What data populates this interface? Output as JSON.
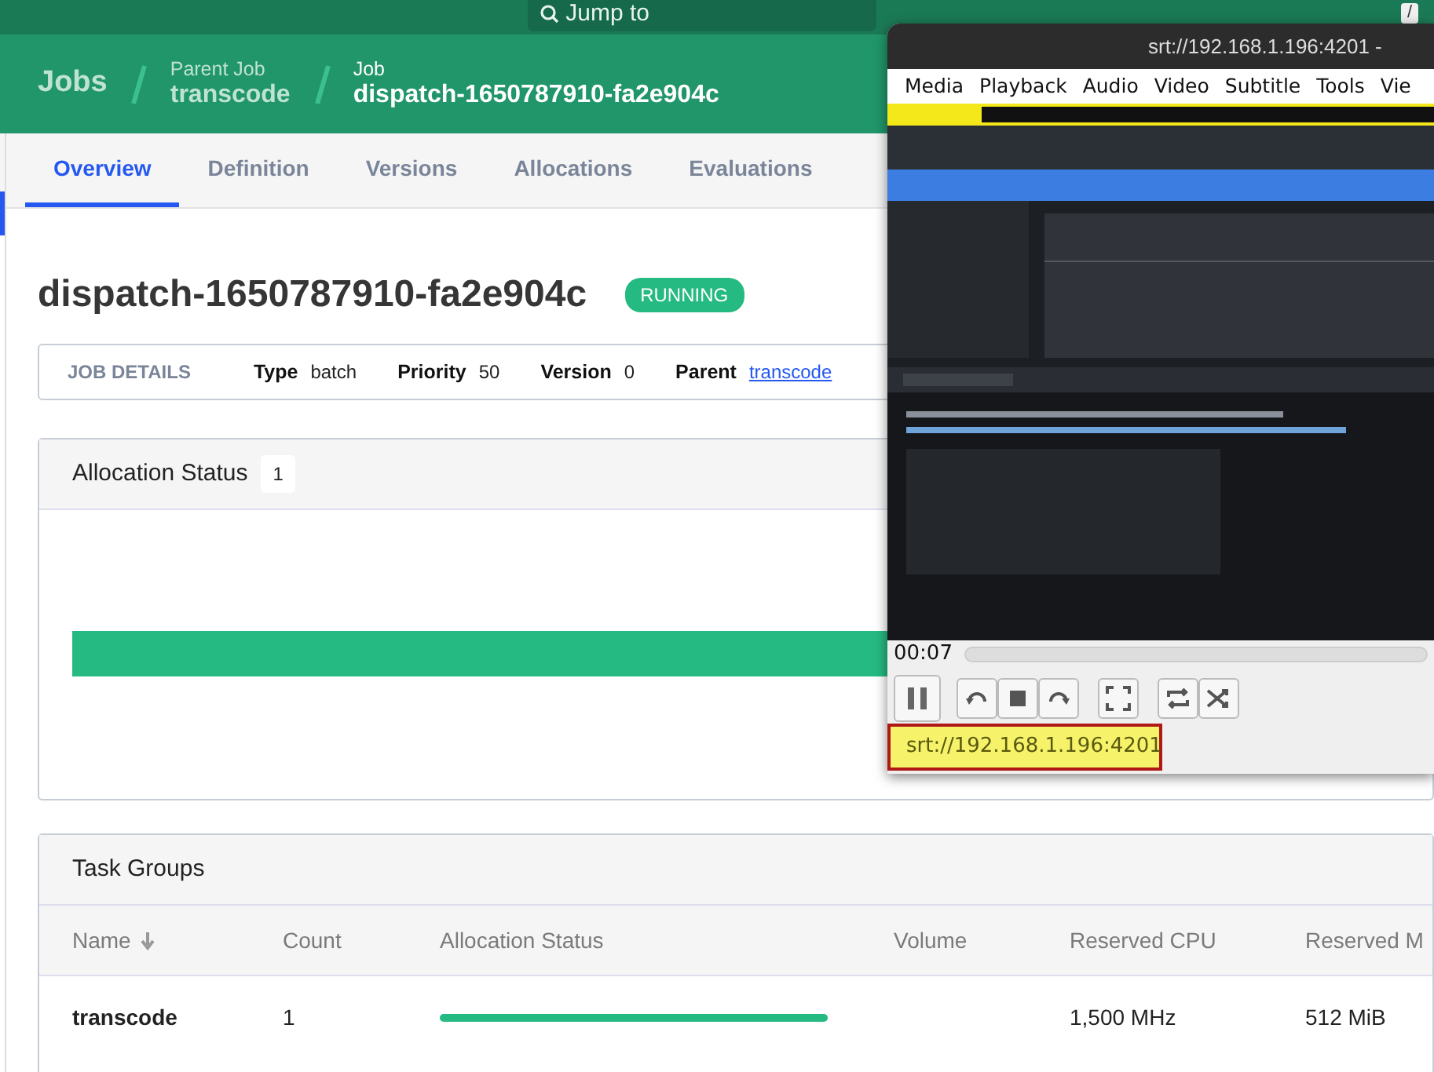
{
  "top_bar": {
    "search_placeholder": "Jump to",
    "shortcut_key": "/"
  },
  "breadcrumbs": [
    {
      "kind": "root",
      "title": "Jobs"
    },
    {
      "kind": "parent",
      "label": "Parent Job",
      "title": "transcode"
    },
    {
      "kind": "current",
      "label": "Job",
      "title": "dispatch-1650787910-fa2e904c"
    }
  ],
  "tabs": [
    {
      "label": "Overview",
      "selected": true
    },
    {
      "label": "Definition",
      "selected": false
    },
    {
      "label": "Versions",
      "selected": false
    },
    {
      "label": "Allocations",
      "selected": false
    },
    {
      "label": "Evaluations",
      "selected": false
    }
  ],
  "job": {
    "title": "dispatch-1650787910-fa2e904c",
    "status": "RUNNING"
  },
  "job_details": {
    "heading": "JOB DETAILS",
    "fields": [
      {
        "kind": "text",
        "label": "Type",
        "value": "batch"
      },
      {
        "kind": "text",
        "label": "Priority",
        "value": "50"
      },
      {
        "kind": "text",
        "label": "Version",
        "value": "0"
      },
      {
        "kind": "link",
        "label": "Parent",
        "value": "transcode"
      }
    ]
  },
  "allocation_status": {
    "title": "Allocation Status",
    "count": "1",
    "level": 1
  },
  "task_groups": {
    "title": "Task Groups",
    "columns": [
      {
        "label": "Name",
        "sorted": true
      },
      {
        "label": "Count",
        "sorted": false
      },
      {
        "label": "Allocation Status",
        "sorted": false
      },
      {
        "label": "Volume",
        "sorted": false
      },
      {
        "label": "Reserved CPU",
        "sorted": false
      },
      {
        "label": "Reserved M",
        "sorted": false
      }
    ],
    "rows": [
      {
        "name": "transcode",
        "count": "1",
        "level": 1,
        "reserved_cpu": "1,500 MHz",
        "reserved_memory": "512 MiB"
      }
    ]
  },
  "player": {
    "title": "srt://192.168.1.196:4201 -",
    "menu": [
      "Media",
      "Playback",
      "Audio",
      "Video",
      "Subtitle",
      "Tools",
      "Vie"
    ],
    "elapsed": "00:07",
    "seek": {
      "level": 0
    },
    "playing": true,
    "status_text": "srt://192.168.1.196:4201"
  }
}
